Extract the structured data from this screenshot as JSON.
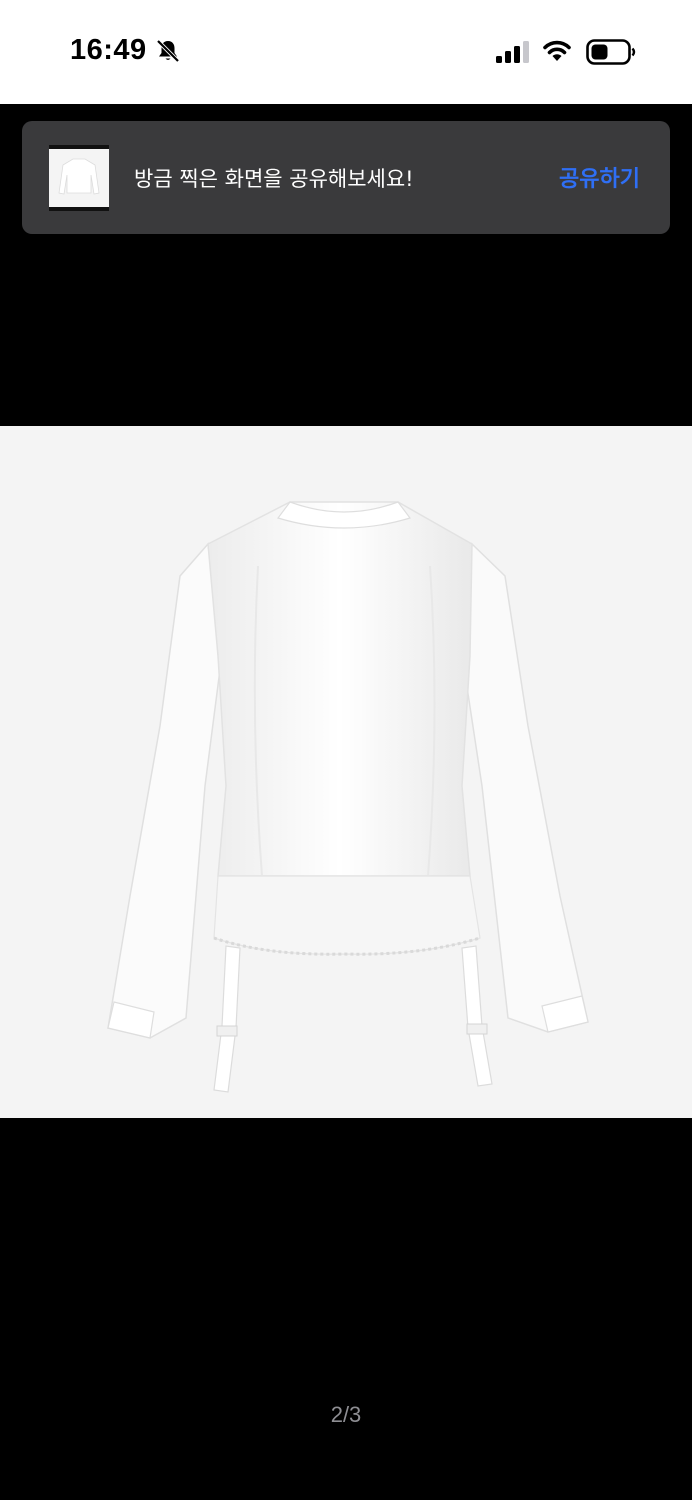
{
  "status_bar": {
    "time": "16:49",
    "icons": [
      "bell-muted-icon",
      "cellular-signal-icon",
      "wifi-icon",
      "battery-icon"
    ]
  },
  "share_toast": {
    "message": "방금 찍은 화면을 공유해보세요!",
    "action_label": "공유하기",
    "action_color": "#2f6ff5",
    "thumbnail": "product-thumbnail"
  },
  "photo": {
    "subject": "white-shirt-garment",
    "background_color": "#f4f4f4"
  },
  "pagination": {
    "indicator": "2/3"
  }
}
